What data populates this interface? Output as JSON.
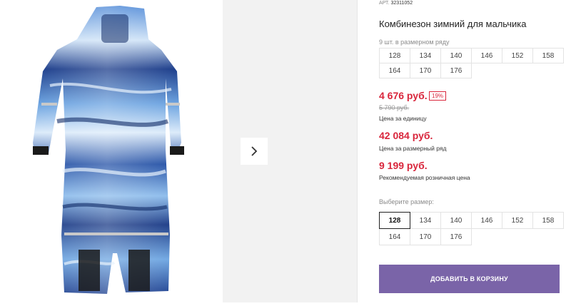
{
  "product": {
    "art_label": "АРТ.",
    "art_value": "32311052",
    "title": "Комбинезон зимний для мальчика",
    "pack_note": "9 шт. в размерном ряду",
    "pack_sizes": [
      "128",
      "134",
      "140",
      "146",
      "152",
      "158",
      "164",
      "170",
      "176"
    ],
    "price_unit": "4 676 руб.",
    "discount_badge": "19%",
    "price_old": "5 790 руб.",
    "price_unit_caption": "Цена за единицу",
    "price_pack": "42 084 руб.",
    "price_pack_caption": "Цена за размерный ряд",
    "price_rrp": "9 199 руб.",
    "price_rrp_caption": "Рекомендуемая розничная цена",
    "choose_size_label": "Выберите размер:",
    "sizes": [
      "128",
      "134",
      "140",
      "146",
      "152",
      "158",
      "164",
      "170",
      "176"
    ],
    "selected_size": "128",
    "add_to_cart": "ДОБАВИТЬ В КОРЗИНУ"
  },
  "gallery": {
    "next_icon": "chevron-right-icon"
  },
  "colors": {
    "accent": "#7a64a8",
    "price_red": "#d9263c",
    "suit_dark": "#1b3c8a",
    "suit_mid": "#3f79cc",
    "suit_light": "#cfe3f7"
  }
}
